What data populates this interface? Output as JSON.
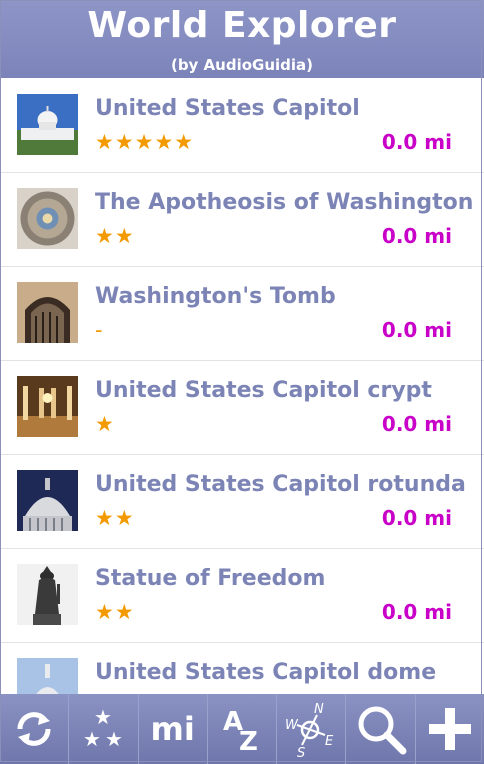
{
  "header": {
    "title": "World Explorer",
    "subtitle": "(by AudioGuidia)"
  },
  "places": [
    {
      "name": "United States Capitol",
      "rating": "★★★★★",
      "distance": "0.0 mi"
    },
    {
      "name": "The Apotheosis of Washington",
      "rating": "★★",
      "distance": "0.0 mi"
    },
    {
      "name": "Washington's Tomb",
      "rating": "-",
      "distance": "0.0 mi"
    },
    {
      "name": "United States Capitol crypt",
      "rating": "★",
      "distance": "0.0 mi"
    },
    {
      "name": "United States Capitol rotunda",
      "rating": "★★",
      "distance": "0.0 mi"
    },
    {
      "name": "Statue of Freedom",
      "rating": "★★",
      "distance": "0.0 mi"
    },
    {
      "name": "United States Capitol dome",
      "rating": "",
      "distance": ""
    }
  ],
  "toolbar": {
    "refresh_icon": "refresh-icon",
    "sort_rating_icon": "stars-sort-icon",
    "units_label": "mi",
    "sort_alpha_icon": "sort-az-icon",
    "compass_icon": "compass-icon",
    "search_icon": "search-icon",
    "add_icon": "add-icon"
  },
  "colors": {
    "header": "#7b83b9",
    "name": "#7c84b6",
    "rating": "#f39a00",
    "distance": "#c800c8"
  }
}
